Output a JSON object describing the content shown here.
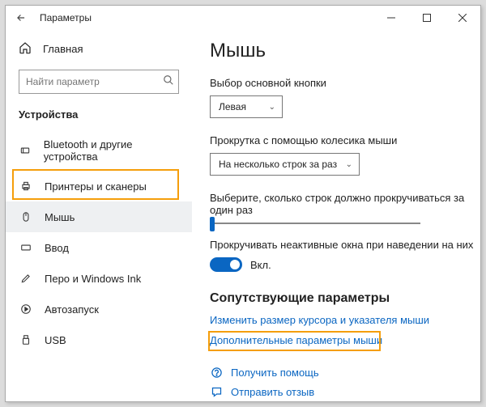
{
  "titlebar": {
    "title": "Параметры"
  },
  "sidebar": {
    "home_label": "Главная",
    "search_placeholder": "Найти параметр",
    "section_title": "Устройства",
    "items": [
      {
        "label": "Bluetooth и другие устройства"
      },
      {
        "label": "Принтеры и сканеры"
      },
      {
        "label": "Мышь"
      },
      {
        "label": "Ввод"
      },
      {
        "label": "Перо и Windows Ink"
      },
      {
        "label": "Автозапуск"
      },
      {
        "label": "USB"
      }
    ]
  },
  "content": {
    "heading": "Мышь",
    "primary_button_label": "Выбор основной кнопки",
    "primary_button_value": "Левая",
    "scroll_label": "Прокрутка с помощью колесика мыши",
    "scroll_value": "На несколько строк за раз",
    "lines_label": "Выберите, сколько строк должно прокручиваться за один раз",
    "inactive_label": "Прокручивать неактивные окна при наведении на них",
    "toggle_state": "Вкл.",
    "related_heading": "Сопутствующие параметры",
    "link_cursor": "Изменить размер курсора и указателя мыши",
    "link_additional": "Дополнительные параметры мыши",
    "help_label": "Получить помощь",
    "feedback_label": "Отправить отзыв"
  }
}
